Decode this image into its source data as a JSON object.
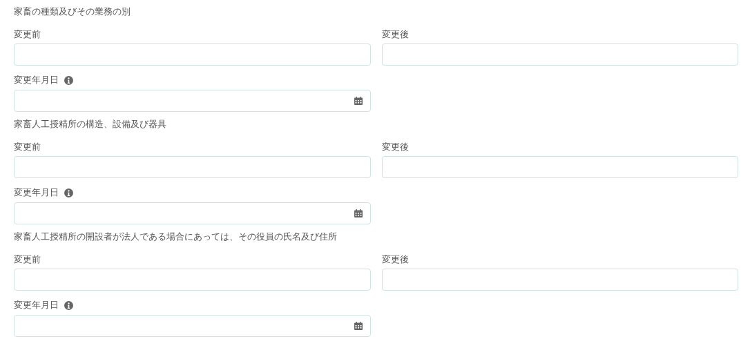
{
  "sections": [
    {
      "title": "家畜の種類及びその業務の別",
      "before_label": "変更前",
      "after_label": "変更後",
      "date_label": "変更年月日"
    },
    {
      "title": "家畜人工授精所の構造、設備及び器具",
      "before_label": "変更前",
      "after_label": "変更後",
      "date_label": "変更年月日"
    },
    {
      "title": "家畜人工授精所の開設者が法人である場合にあっては、その役員の氏名及び住所",
      "before_label": "変更前",
      "after_label": "変更後",
      "date_label": "変更年月日"
    }
  ]
}
